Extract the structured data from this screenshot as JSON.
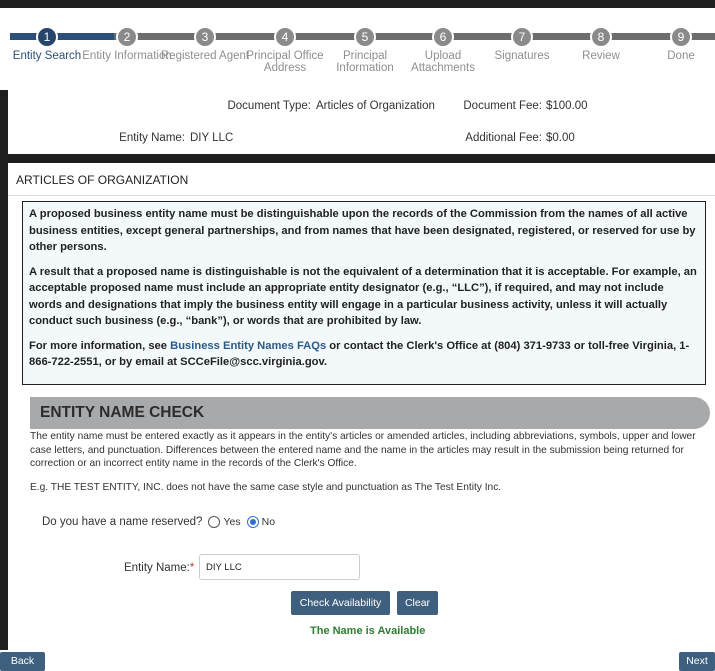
{
  "stepper": {
    "steps": [
      {
        "number": "1",
        "label": "Entity Search"
      },
      {
        "number": "2",
        "label": "Entity Information"
      },
      {
        "number": "3",
        "label": "Registered Agent"
      },
      {
        "number": "4",
        "label": "Principal Office Address"
      },
      {
        "number": "5",
        "label": "Principal Information"
      },
      {
        "number": "6",
        "label": "Upload Attachments"
      },
      {
        "number": "7",
        "label": "Signatures"
      },
      {
        "number": "8",
        "label": "Review"
      },
      {
        "number": "9",
        "label": "Done"
      }
    ]
  },
  "info": {
    "document_type_label": "Document Type:",
    "document_type_value": "Articles of Organization",
    "document_fee_label": "Document Fee:",
    "document_fee_value": "$100.00",
    "entity_name_label": "Entity Name:",
    "entity_name_value": "DIY LLC",
    "additional_fee_label": "Additional Fee:",
    "additional_fee_value": "$0.00"
  },
  "section": {
    "title": "ARTICLES OF ORGANIZATION",
    "notice": {
      "p1": "A proposed business entity name must be distinguishable upon the records of the Commission from the names of all active business entities, except general partnerships, and from names that have been designated, registered, or reserved for use by other persons.",
      "p2": "A result that a proposed name is distinguishable is not the equivalent of a determination that it is acceptable. For example, an acceptable proposed name must include an appropriate entity designator (e.g., “LLC”), if required, and may not include words and designations that imply the business entity will engage in a particular business activity, unless it will actually conduct such business (e.g., “bank”), or words that are prohibited by law.",
      "p3_before": "For more information, see ",
      "p3_link": "Business Entity Names FAQs",
      "p3_after": " or contact the Clerk's Office at (804) 371-9733 or toll-free Virginia, 1-866-722-2551, or by email at SCCeFile@scc.virginia.gov."
    }
  },
  "name_check": {
    "heading": "ENTITY NAME CHECK",
    "description": "The entity name must be entered exactly as it appears in the entity's articles or amended articles, including abbreviations, symbols, upper and lower case letters, and punctuation. Differences between the entered name and the name in the articles may result in the submission being returned for correction or an incorrect entity name in the records of the Clerk's Office.",
    "example": "E.g. THE TEST ENTITY, INC. does not have the same case style and punctuation as The Test Entity Inc.",
    "reserved_question": "Do you have a name reserved?",
    "option_yes": "Yes",
    "option_no": "No",
    "entity_name_label": "Entity Name:",
    "required_mark": "*",
    "entity_name_value": "DIY LLC",
    "check_button": "Check Availability",
    "clear_button": "Clear",
    "result": "The Name is Available"
  },
  "footer": {
    "back": "Back",
    "next": "Next"
  }
}
